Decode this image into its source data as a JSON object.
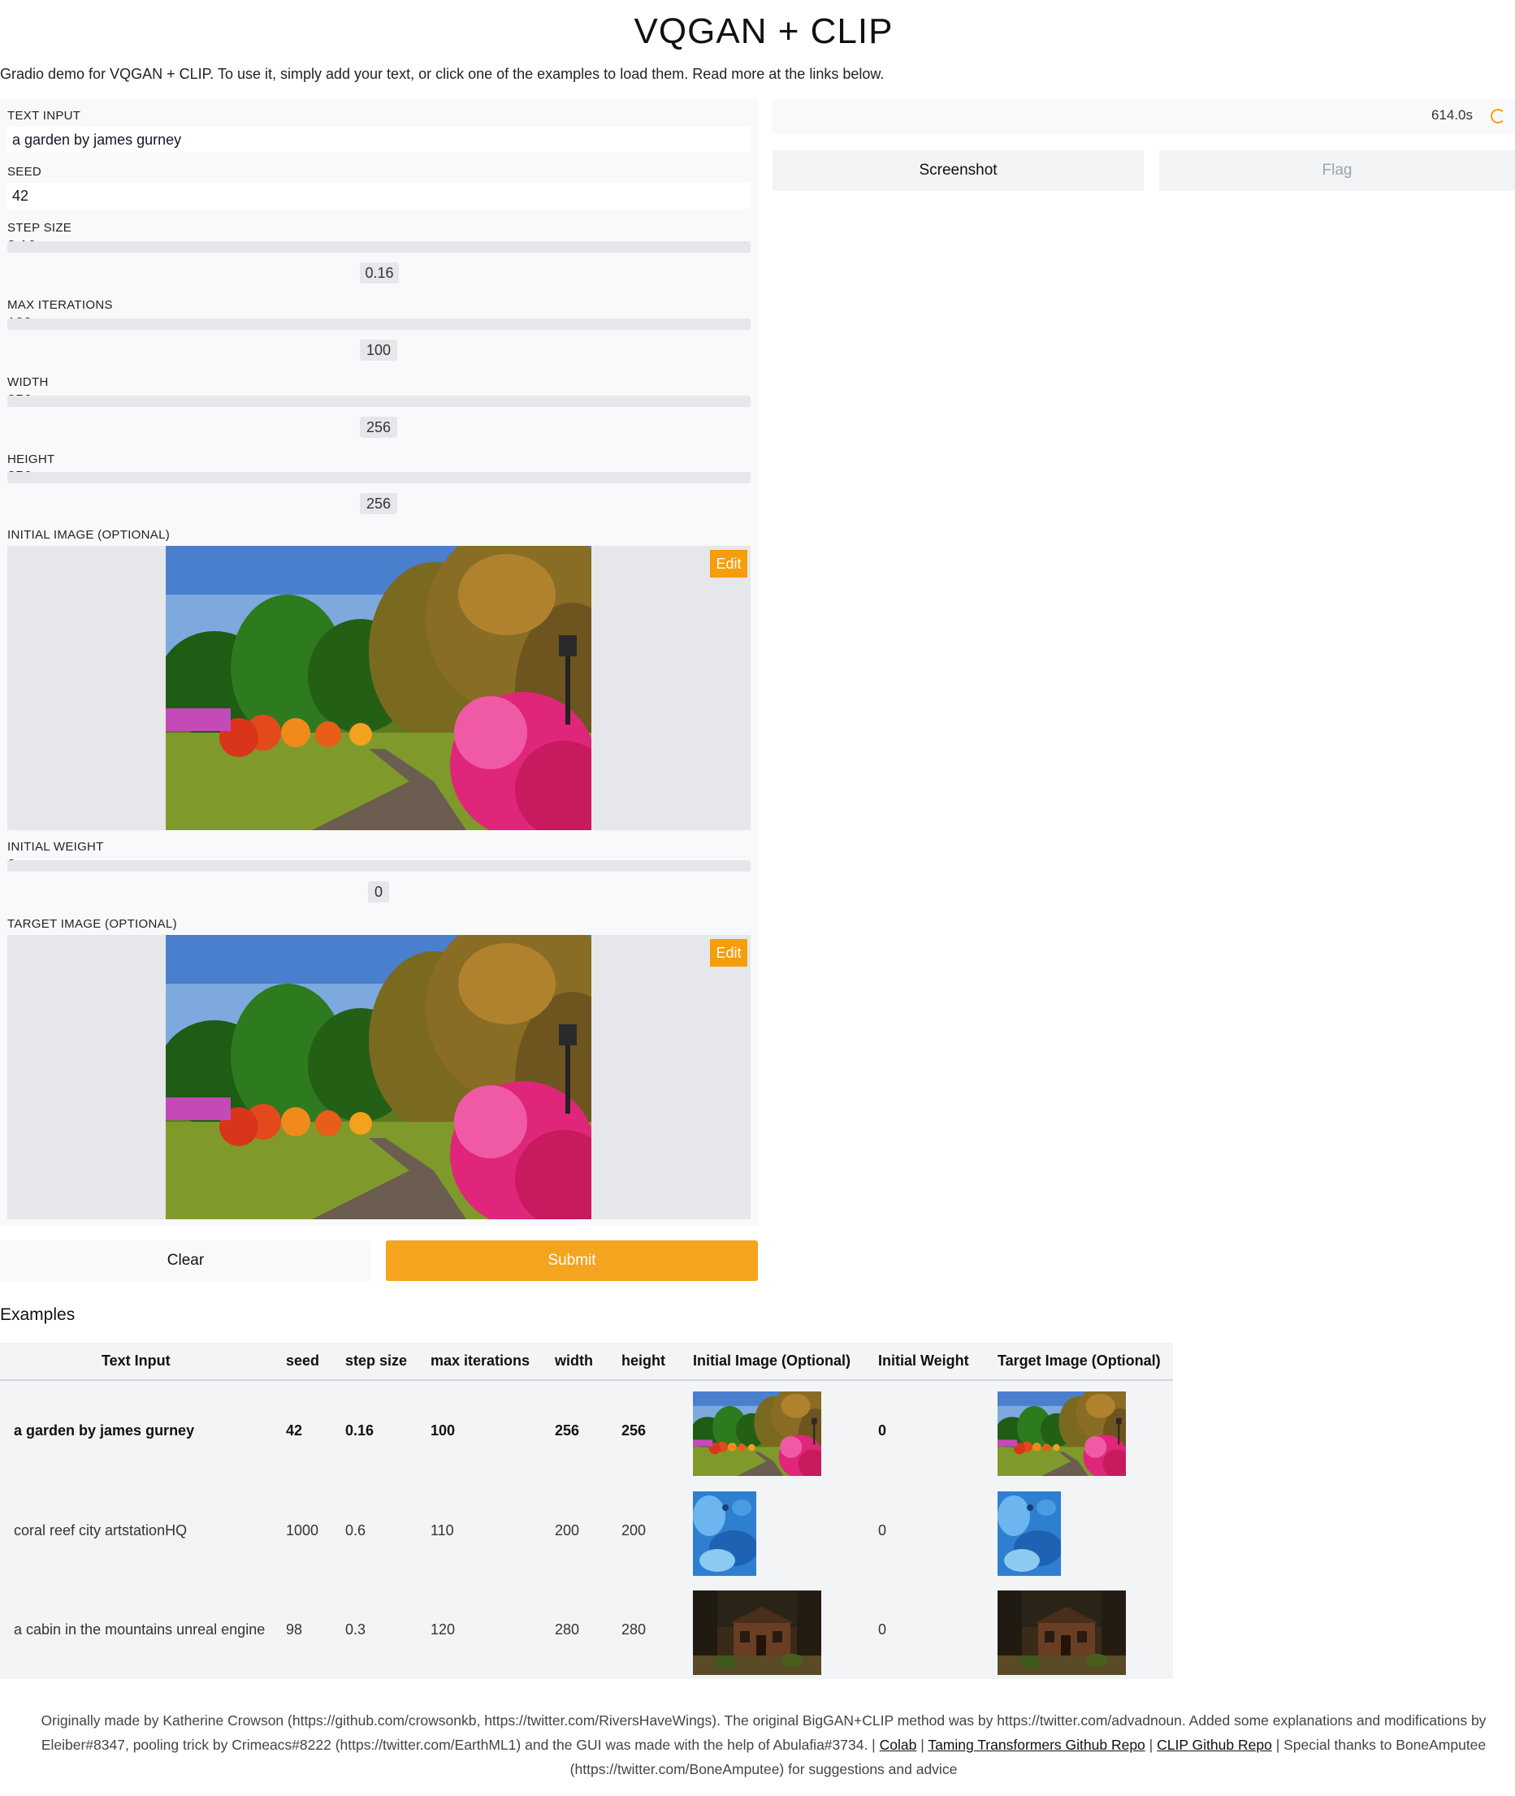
{
  "header": {
    "title": "VQGAN + CLIP",
    "description": "Gradio demo for VQGAN + CLIP. To use it, simply add your text, or click one of the examples to load them. Read more at the links below."
  },
  "inputs": {
    "text_input": {
      "label": "TEXT INPUT",
      "value": "a garden by james gurney"
    },
    "seed": {
      "label": "SEED",
      "value": "42"
    },
    "step_size": {
      "label": "STEP SIZE",
      "value": "0.16",
      "fraction": 0.16
    },
    "max_iterations": {
      "label": "MAX ITERATIONS",
      "value": "100"
    },
    "width": {
      "label": "WIDTH",
      "value": "256"
    },
    "height": {
      "label": "HEIGHT",
      "value": "256"
    },
    "initial_image": {
      "label": "INITIAL IMAGE (OPTIONAL)",
      "edit_label": "Edit"
    },
    "initial_weight": {
      "label": "INITIAL WEIGHT",
      "value": "0"
    },
    "target_image": {
      "label": "TARGET IMAGE (OPTIONAL)",
      "edit_label": "Edit"
    }
  },
  "actions": {
    "clear_label": "Clear",
    "submit_label": "Submit",
    "submit_color": "#f59e0b"
  },
  "output": {
    "timer": "614.0s",
    "screenshot_label": "Screenshot",
    "flag_label": "Flag"
  },
  "examples": {
    "title": "Examples",
    "headers": [
      "Text Input",
      "seed",
      "step size",
      "max iterations",
      "width",
      "height",
      "Initial Image (Optional)",
      "Initial Weight",
      "Target Image (Optional)"
    ],
    "rows": [
      {
        "text": "a garden by james gurney",
        "seed": "42",
        "step": "0.16",
        "iters": "100",
        "width": "256",
        "height": "256",
        "init_weight": "0",
        "image": "garden"
      },
      {
        "text": "coral reef city artstationHQ",
        "seed": "1000",
        "step": "0.6",
        "iters": "110",
        "width": "200",
        "height": "200",
        "init_weight": "0",
        "image": "coral-reef"
      },
      {
        "text": "a cabin in the mountains unreal engine",
        "seed": "98",
        "step": "0.3",
        "iters": "120",
        "width": "280",
        "height": "280",
        "init_weight": "0",
        "image": "cabin"
      }
    ]
  },
  "footer": {
    "text_1": "Originally made by Katherine Crowson (https://github.com/crowsonkb, https://twitter.com/RiversHaveWings). The original BigGAN+CLIP method was by https://twitter.com/advadnoun. Added some explanations and modifications by",
    "text_2": "Eleiber#8347, pooling trick by Crimeacs#8222 (https://twitter.com/EarthML1) and the GUI was made with the help of Abulafia#3734. |",
    "link_colab": "Colab",
    "sep_1": "|",
    "link_taming": "Taming Transformers Github Repo",
    "sep_2": "|",
    "link_clip": "CLIP Github Repo",
    "text_3": "| Special thanks to BoneAmputee",
    "text_4": "(https://twitter.com/BoneAmputee) for suggestions and advice"
  },
  "colors": {
    "accent": "#f59e0b",
    "panel_bg": "#f8f9fa",
    "track_bg": "#e5e7eb",
    "table_bg": "#f3f4f6"
  }
}
